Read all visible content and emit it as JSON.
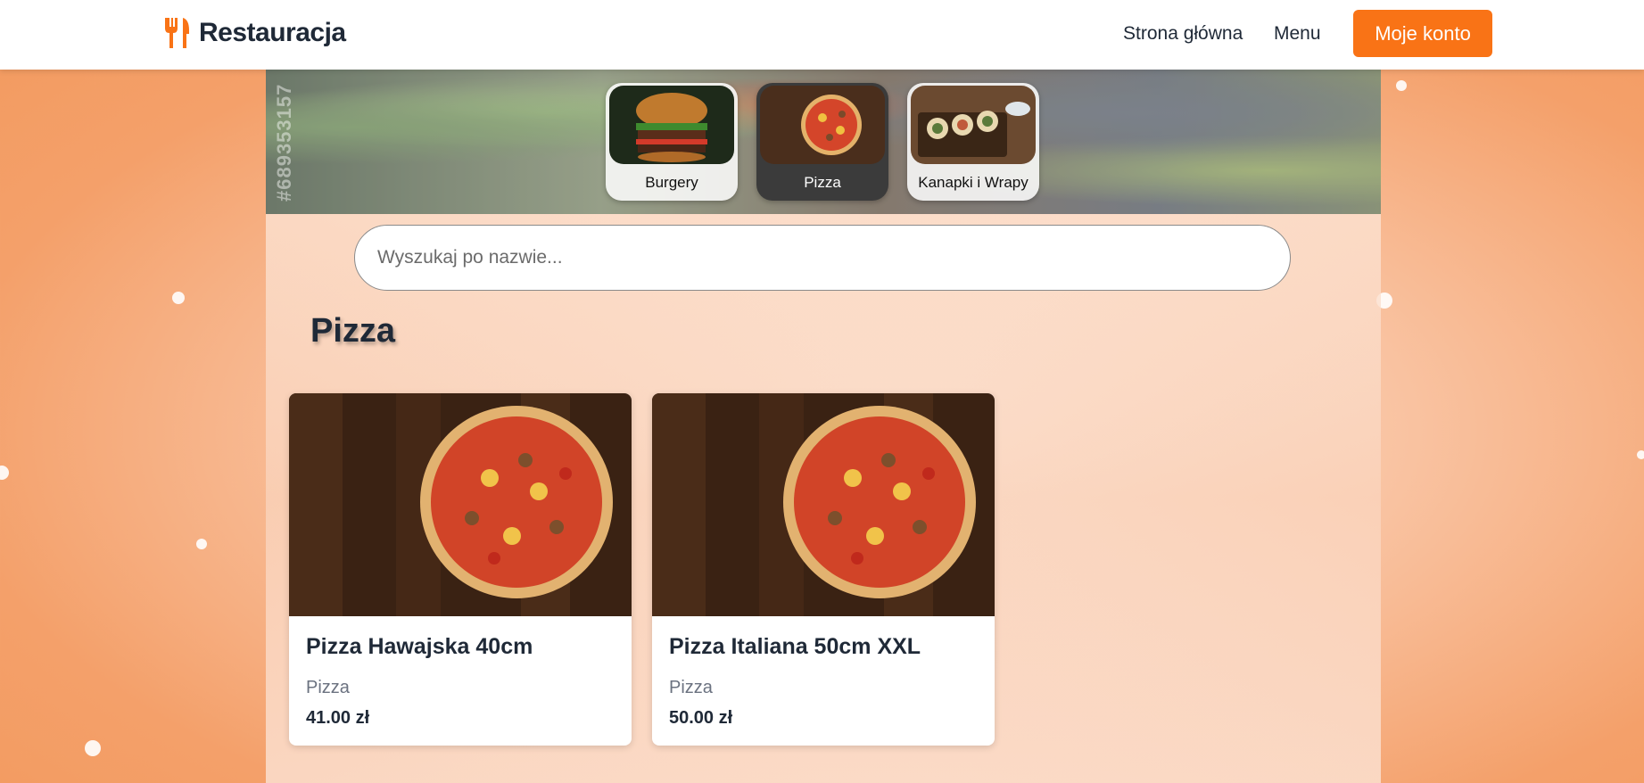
{
  "header": {
    "logo_text": "Restauracja",
    "logo_icon": "utensils-icon",
    "nav": {
      "home": "Strona główna",
      "menu": "Menu",
      "account": "Moje konto"
    }
  },
  "banner": {
    "code": "#689353157"
  },
  "categories": [
    {
      "label": "Burgery",
      "active": false
    },
    {
      "label": "Pizza",
      "active": true
    },
    {
      "label": "Kanapki i Wrapy",
      "active": false
    }
  ],
  "search": {
    "placeholder": "Wyszukaj po nazwie...",
    "value": ""
  },
  "section": {
    "title": "Pizza"
  },
  "products": [
    {
      "name": "Pizza Hawajska 40cm",
      "category": "Pizza",
      "price": "41.00 zł"
    },
    {
      "name": "Pizza Italiana 50cm XXL",
      "category": "Pizza",
      "price": "50.00 zł"
    }
  ],
  "colors": {
    "accent": "#f97316",
    "text": "#1f2937",
    "muted": "#6b7280"
  }
}
